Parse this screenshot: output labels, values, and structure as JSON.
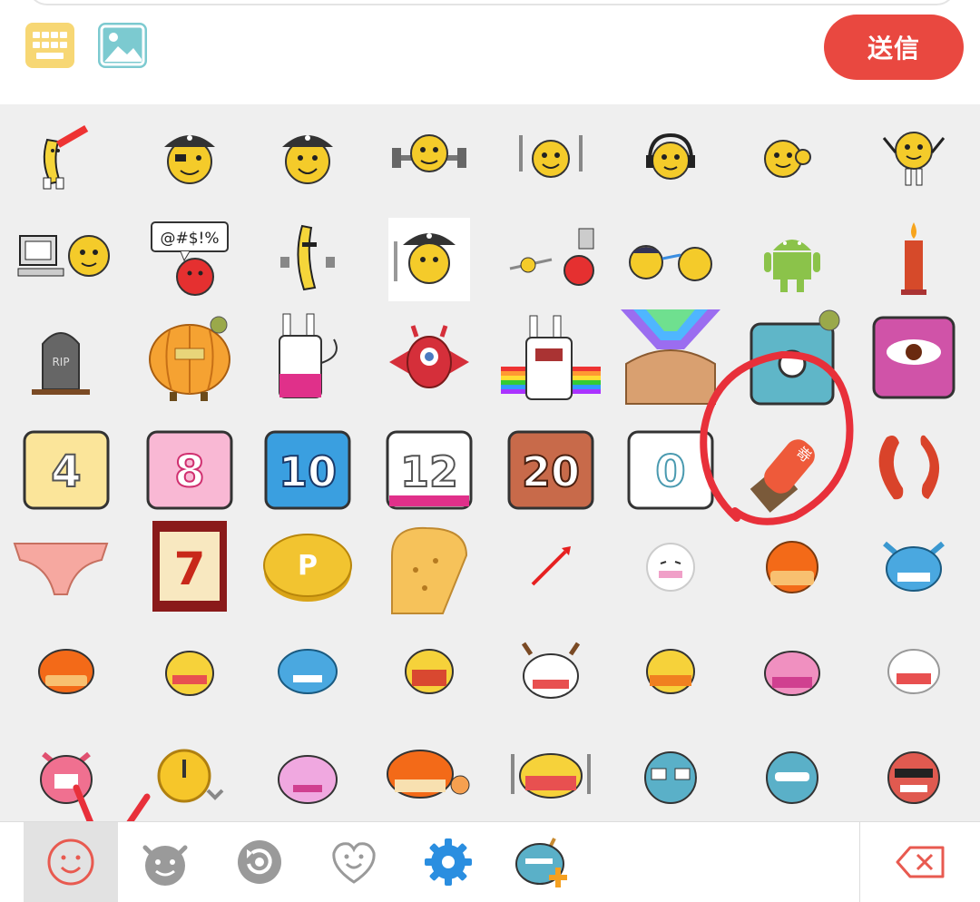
{
  "toolbar": {
    "send_label": "送信",
    "keyboard_icon": "keyboard-icon",
    "image_icon": "image-icon",
    "colors": {
      "send": "#e94840",
      "keyboard": "#f7d774",
      "image": "#7ccad0"
    }
  },
  "emoji_grid": {
    "columns": 8,
    "rows": [
      [
        "dancing-banana-guitar",
        "pirate-smiley",
        "pirate-smiley-2",
        "weightlifter-smiley",
        "knife-fork-smiley",
        "headphones-smiley",
        "waving-smiley",
        "cheering-smiley"
      ],
      [
        "computer-smiley",
        "swearing-smiley",
        "dancing-banana",
        "pirate-sword-smiley",
        "shooting-smiley",
        "duel-smileys",
        "android-robot",
        "candle"
      ],
      [
        "tombstone",
        "pumpkin",
        "white-rabbit",
        "red-winged-monster",
        "rainbow-rabbit",
        "rainbow-muscle-man",
        "teal-square-face",
        "pink-eye-square"
      ],
      [
        "calendar-4",
        "calendar-8",
        "calendar-10",
        "calendar-12",
        "calendar-20",
        "calendar-0",
        "stamp",
        "sausage"
      ],
      [
        "pink-panties",
        "slot-seven",
        "gold-coin",
        "toast",
        "red-flag-pin",
        "white-face",
        "orange-face",
        "blue-face"
      ],
      [
        "orange-mouth-face",
        "yellow-wince-face",
        "blue-fish-face",
        "yellow-open-mouth",
        "reindeer-face",
        "yellow-lips-face",
        "pink-pig-face",
        "white-grin-face"
      ],
      [
        "pink-cat-face",
        "clock-face",
        "pink-bunny-face",
        "orange-ok-face",
        "dining-face",
        "teal-glasses-face",
        "teal-face",
        "red-sunglasses-face"
      ]
    ],
    "calendar_labels": [
      "4",
      "8",
      "10",
      "12",
      "20",
      "0"
    ],
    "stamp_text": "嵜",
    "tombstone_text": "RIP",
    "swear_text": "@#$!%",
    "slot_text": "7",
    "coin_text": "P"
  },
  "tabs": [
    {
      "name": "smiley-icon",
      "active": true
    },
    {
      "name": "devil-icon",
      "active": false
    },
    {
      "name": "history-icon",
      "active": false
    },
    {
      "name": "heart-face-icon",
      "active": false
    },
    {
      "name": "gear-icon",
      "active": false
    },
    {
      "name": "add-sticker-icon",
      "active": false
    }
  ],
  "backspace_icon": "backspace-icon",
  "annotation_color": "#e8303a"
}
